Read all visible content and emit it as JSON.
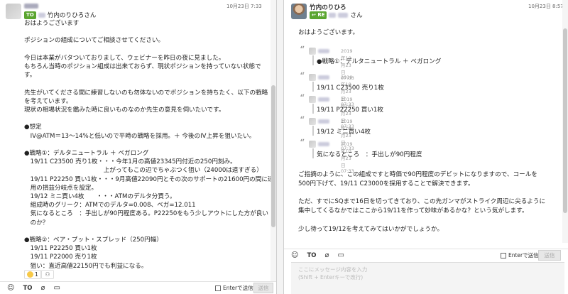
{
  "left_message": {
    "to_badge": "TO",
    "recipient": "竹内のりひろさん",
    "timestamp": "10月23日 7:33",
    "body_lines": [
      "おはようございます",
      "",
      "ポジションの組成についてご相談させてください。",
      "",
      "今日は本業がバタついておりまして、ウェビナーを昨日の夜に見ました。",
      "もちろん当時のポジション組成は出来ておらず、現状ポジションを持っていない状態で",
      "す。",
      "",
      "先生がいてくださる間に練習しないのも勿体ないのでポジションを持ちたく、以下の戦略",
      "を考えています。",
      "現状の相場状況を鑑みた時に良いものなのか先生の意見を伺いたいです。",
      "",
      "●想定",
      "　IV@ATM＝13〜14%と低いので平時の戦略を採用。＋ 今後のIV上昇を狙いたい。",
      "",
      "●戦略①：デルタニュートラル ＋ ベガロング",
      "　19/11 C23500 売り1枚・・・今年1月の高値23345円付近の250円刻み。",
      "　　　　　　　　　　　　　上がってもこの辺でちゃぶつく狙い（24000は遠すぎる）",
      "　19/11 P22250 買い1枚・・・9月高値22090円とその次のサポートの21600円の間に適",
      "　用の損益分岐点を設定。",
      "　19/12 ミニ買い4枚　　・・・ATMのデルタ分買う。",
      "　組成時のグリーク：ATMでのデルタ=0.008、ベガ=12.011",
      "　気になるところ　：手出しが90円程度ある。P22250をもう少しアウトにした方が良い",
      "　のか？",
      "",
      "●戦略②：ベア・プット・スプレッド（250円幅）",
      "　19/11 P22250 買い1枚",
      "　19/11 P22000 売り1枚",
      "　狙い：直近高値22150円でも利益になる。"
    ],
    "reaction_count": "1"
  },
  "right_message": {
    "re_badge": "RE",
    "sender": "竹内のりひろ",
    "recipient_suffix": "さん",
    "timestamp": "10月23日 8:57",
    "greeting": "おはようございます。",
    "quotes": [
      {
        "date": "2019年10月23日 07:33",
        "text": "●戦略①：デルタニュートラル ＋ ベガロング"
      },
      {
        "date": "2019年10月23日 07:33",
        "text": "19/11 C23500 売り1枚"
      },
      {
        "date": "2019年10月23日 07:33",
        "text": "19/11 P22250 買い1枚"
      },
      {
        "date": "2019年10月23日 07:33",
        "text": "19/12 ミニ買い4枚"
      },
      {
        "date": "2019年10月23日 07:33",
        "text": "気になるところ　：手出しが90円程度"
      }
    ],
    "closing_lines": [
      "ご指摘のように、この組成ですと時価で90円程度のデビットになりますので、コールを",
      "500円下げて、19/11 C23000を採用することで解決できます。",
      "",
      "ただ、すでにSQまで16日を切ってきており、この先ガンマがストライク周辺に尖るように",
      "集中してくるなかではここから19/11を作って妙味があるかな？という気がします。",
      "",
      "少し待って19/12を考えてみてはいかがでしょうか。"
    ]
  },
  "toolbar": {
    "to_label": "TO",
    "enter_label": "Enterで送信",
    "send_label": "送信"
  },
  "composer": {
    "placeholder_line1": "ここにメッセージ内容を入力",
    "placeholder_line2": "(Shift + Enterキーで改行)"
  },
  "colors": {
    "badge_green": "#5aa52f",
    "reaction_yellow": "#f7c948"
  }
}
